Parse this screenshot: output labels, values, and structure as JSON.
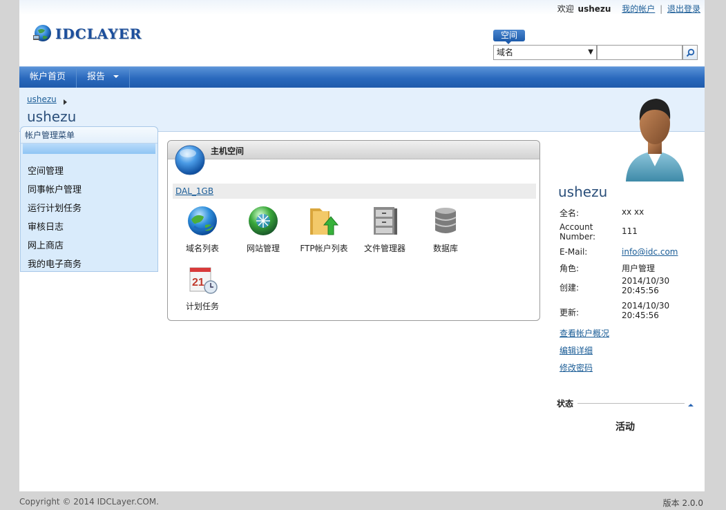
{
  "header": {
    "welcome_prefix": "欢迎",
    "username": "ushezu",
    "my_account": "我的帐户",
    "separator": "|",
    "logout": "退出登录",
    "logo_text": "IDCLAYER"
  },
  "search": {
    "tag": "空间",
    "selected_option": "域名",
    "input_value": ""
  },
  "nav": {
    "home": "帐户首页",
    "reports": "报告"
  },
  "breadcrumb": {
    "item": "ushezu"
  },
  "page_title": "ushezu",
  "left_menu": {
    "title": "帐户管理菜单",
    "items": [
      "空间管理",
      "同事帐户管理",
      "运行计划任务",
      "审核日志",
      "网上商店",
      "我的电子商务"
    ]
  },
  "hosting": {
    "title": "主机空间",
    "plan": "DAL_1GB",
    "tools": [
      {
        "label": "域名列表",
        "icon": "globe-icon"
      },
      {
        "label": "网站管理",
        "icon": "website-globe-icon"
      },
      {
        "label": "FTP帐户列表",
        "icon": "folder-upload-icon"
      },
      {
        "label": "文件管理器",
        "icon": "file-cabinet-icon"
      },
      {
        "label": "数据库",
        "icon": "database-icon"
      },
      {
        "label": "计划任务",
        "icon": "calendar-clock-icon"
      }
    ]
  },
  "profile": {
    "name": "ushezu",
    "fields": [
      {
        "key": "全名:",
        "value": "xx xx"
      },
      {
        "key": "Account Number:",
        "value": "111"
      },
      {
        "key": "E-Mail:",
        "value": "info@idc.com"
      },
      {
        "key": "角色:",
        "value": "用户管理"
      },
      {
        "key": "创建:",
        "value": "2014/10/30 20:45:56"
      },
      {
        "key": "更新:",
        "value": "2014/10/30 20:45:56"
      }
    ],
    "links": [
      "查看帐户概况",
      "编辑详细",
      "修改密码"
    ],
    "status_label": "状态",
    "status_value": "活动"
  },
  "footer": {
    "copyright": "Copyright © 2014 IDCLayer.COM.",
    "version": "版本 2.0.0"
  }
}
